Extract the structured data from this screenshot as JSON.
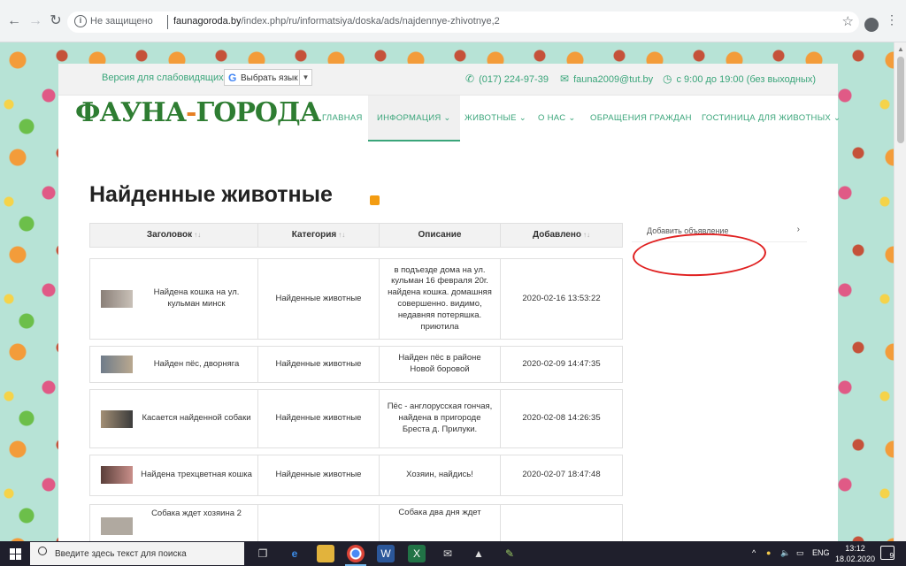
{
  "browser": {
    "not_secure": "Не защищено",
    "url_host": "faunagoroda.by",
    "url_path": "/index.php/ru/informatsiya/doska/ads/najdennye-zhivotnye,2"
  },
  "topbar": {
    "low_vision": "Версия для слабовидящих",
    "translate_label": "Выбрать язык",
    "phone": "(017) 224-97-39",
    "email": "fauna2009@tut.by",
    "hours": "с 9:00 до 19:00 (без выходных)"
  },
  "logo": {
    "text_1": "ФАУНА",
    "text_2": "ГОРОДА"
  },
  "nav": [
    {
      "label": "ГЛАВНАЯ"
    },
    {
      "label": "ИНФОРМАЦИЯ ⌄"
    },
    {
      "label": "ЖИВОТНЫЕ ⌄"
    },
    {
      "label": "О НАС ⌄"
    },
    {
      "label": "ОБРАЩЕНИЯ ГРАЖДАН"
    },
    {
      "label": "ГОСТИНИЦА ДЛЯ ЖИВОТНЫХ ⌄"
    }
  ],
  "page_title": "Найденные животные",
  "sidebar": {
    "add_ad": "Добавить объявление",
    "chevron": "›"
  },
  "table": {
    "headers": [
      {
        "label": "Заголовок",
        "sort": "↑↓"
      },
      {
        "label": "Категория",
        "sort": "↑↓"
      },
      {
        "label": "Описание",
        "sort": ""
      },
      {
        "label": "Добавлено",
        "sort": "↑↓"
      }
    ],
    "rows": [
      {
        "title": "Найдена кошка на ул. кульман минск",
        "category": "Найденные животные",
        "description": "в подъезде дома на ул. кульман 16 февраля 20г. найдена кошка. домашняя совершенно. видимо, недавняя потеряшка. приютила",
        "date": "2020-02-16 13:53:22"
      },
      {
        "title": "Найден пёс, дворняга",
        "category": "Найденные животные",
        "description": "Найден пёс в районе Новой боровой",
        "date": "2020-02-09 14:47:35"
      },
      {
        "title": "Касается найденной собаки",
        "category": "Найденные животные",
        "description": "Пёс - англорусская гончая, найдена в пригороде Бреста д. Прилуки.",
        "date": "2020-02-08 14:26:35"
      },
      {
        "title": "Найдена трехцветная кошка",
        "category": "Найденные животные",
        "description": "Хозяин, найдись!",
        "date": "2020-02-07 18:47:48"
      },
      {
        "title": "Собака ждет хозяина 2",
        "category": "",
        "description": "Собака два дня ждет",
        "date": ""
      }
    ]
  },
  "taskbar": {
    "search_placeholder": "Введите здесь текст для поиска",
    "lang": "ENG",
    "time": "13:12",
    "date": "18.02.2020",
    "notifications": "9"
  }
}
